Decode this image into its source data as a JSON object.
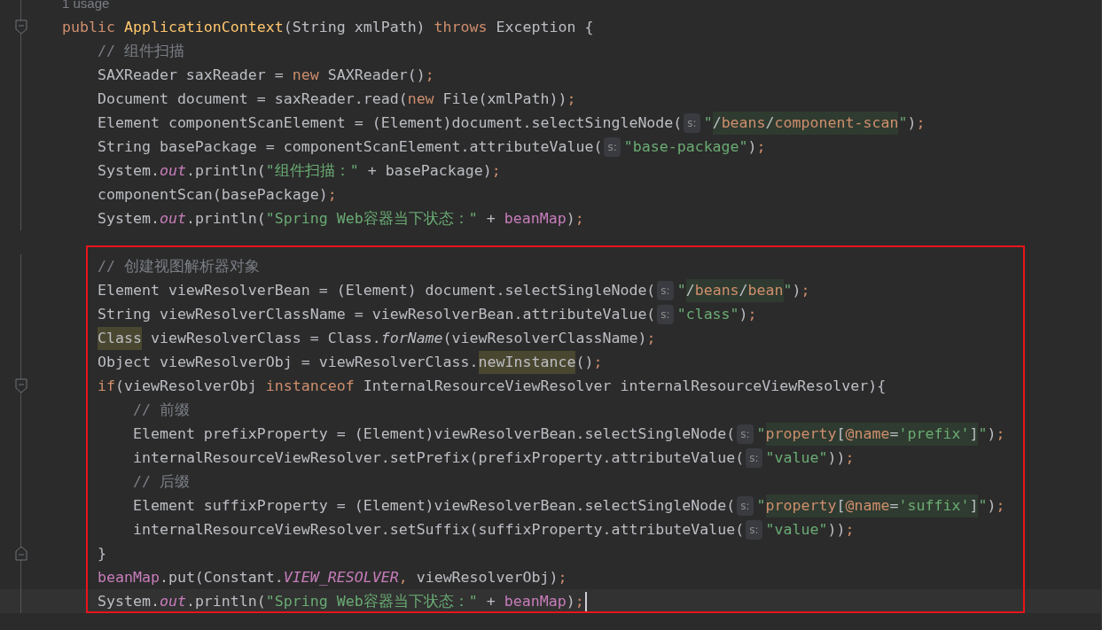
{
  "editor": {
    "groups": [
      {
        "lines": [
          {
            "lens": "1 usage"
          },
          {
            "fold_start": true,
            "tokens": [
              {
                "kind": "kw",
                "text": "public "
              },
              {
                "kind": "decl",
                "text": "ApplicationContext"
              },
              {
                "kind": "p",
                "text": "(String xmlPath) "
              },
              {
                "kind": "kw",
                "text": "throws "
              },
              {
                "kind": "p",
                "text": "Exception {"
              }
            ]
          },
          {
            "tokens": [
              {
                "kind": "cmt",
                "text": "    // 组件扫描"
              }
            ]
          },
          {
            "tokens": [
              {
                "kind": "p",
                "text": "    SAXReader saxReader = "
              },
              {
                "kind": "kw",
                "text": "new "
              },
              {
                "kind": "p",
                "text": "SAXReader()"
              },
              {
                "kind": "kw",
                "text": ";"
              }
            ]
          },
          {
            "tokens": [
              {
                "kind": "p",
                "text": "    Document document = saxReader.read("
              },
              {
                "kind": "kw",
                "text": "new "
              },
              {
                "kind": "p",
                "text": "File(xmlPath))"
              },
              {
                "kind": "kw",
                "text": ";"
              }
            ]
          },
          {
            "tokens": [
              {
                "kind": "p",
                "text": "    Element componentScanElement = (Element)document.selectSingleNode("
              },
              {
                "kind": "hint",
                "text": "s:"
              },
              {
                "kind": "str",
                "text": "\""
              },
              {
                "kind": "injp",
                "text": "/"
              },
              {
                "kind": "injk",
                "text": "beans"
              },
              {
                "kind": "injp",
                "text": "/"
              },
              {
                "kind": "injk",
                "text": "component-scan"
              },
              {
                "kind": "str",
                "text": "\""
              },
              {
                "kind": "p",
                "text": ")"
              },
              {
                "kind": "kw",
                "text": ";"
              }
            ]
          },
          {
            "tokens": [
              {
                "kind": "p",
                "text": "    String basePackage = componentScanElement.attributeValue("
              },
              {
                "kind": "hint",
                "text": "s:"
              },
              {
                "kind": "str",
                "text": "\"base-package\""
              },
              {
                "kind": "p",
                "text": ")"
              },
              {
                "kind": "kw",
                "text": ";"
              }
            ]
          },
          {
            "tokens": [
              {
                "kind": "p",
                "text": "    System."
              },
              {
                "kind": "field",
                "text": "out"
              },
              {
                "kind": "p",
                "text": ".println("
              },
              {
                "kind": "str",
                "text": "\"组件扫描：\""
              },
              {
                "kind": "p",
                "text": " + basePackage)"
              },
              {
                "kind": "kw",
                "text": ";"
              }
            ]
          },
          {
            "tokens": [
              {
                "kind": "p",
                "text": "    componentScan(basePackage)"
              },
              {
                "kind": "kw",
                "text": ";"
              }
            ]
          },
          {
            "tokens": [
              {
                "kind": "p",
                "text": "    System."
              },
              {
                "kind": "field",
                "text": "out"
              },
              {
                "kind": "p",
                "text": ".println("
              },
              {
                "kind": "str",
                "text": "\"Spring Web容器当下状态：\""
              },
              {
                "kind": "p",
                "text": " + "
              },
              {
                "kind": "fieldp",
                "text": "beanMap"
              },
              {
                "kind": "p",
                "text": ")"
              },
              {
                "kind": "kw",
                "text": ";"
              }
            ]
          }
        ]
      },
      {
        "framed": true,
        "lines": [
          {
            "tokens": [
              {
                "kind": "cmt",
                "text": "    // 创建视图解析器对象"
              }
            ]
          },
          {
            "tokens": [
              {
                "kind": "p",
                "text": "    Element viewResolverBean = (Element) document.selectSingleNode("
              },
              {
                "kind": "hint",
                "text": "s:"
              },
              {
                "kind": "str",
                "text": "\""
              },
              {
                "kind": "injp",
                "text": "/"
              },
              {
                "kind": "injk",
                "text": "beans"
              },
              {
                "kind": "injp",
                "text": "/"
              },
              {
                "kind": "injk",
                "text": "bean"
              },
              {
                "kind": "str",
                "text": "\""
              },
              {
                "kind": "p",
                "text": ")"
              },
              {
                "kind": "kw",
                "text": ";"
              }
            ]
          },
          {
            "tokens": [
              {
                "kind": "p",
                "text": "    String viewResolverClassName = viewResolverBean.attributeValue("
              },
              {
                "kind": "hint",
                "text": "s:"
              },
              {
                "kind": "str",
                "text": "\"class\""
              },
              {
                "kind": "p",
                "text": ")"
              },
              {
                "kind": "kw",
                "text": ";"
              }
            ]
          },
          {
            "tokens": [
              {
                "kind": "occ",
                "text": "    Class"
              },
              {
                "kind": "p",
                "text": " viewResolverClass = Class."
              },
              {
                "kind": "static",
                "text": "forName"
              },
              {
                "kind": "p",
                "text": "(viewResolverClassName)"
              },
              {
                "kind": "kw",
                "text": ";"
              }
            ]
          },
          {
            "tokens": [
              {
                "kind": "p",
                "text": "    Object viewResolverObj = viewResolverClass."
              },
              {
                "kind": "occ",
                "text": "newInstance"
              },
              {
                "kind": "p",
                "text": "()"
              },
              {
                "kind": "kw",
                "text": ";"
              }
            ]
          },
          {
            "fold_start": true,
            "tokens": [
              {
                "kind": "kw",
                "text": "    if"
              },
              {
                "kind": "p",
                "text": "(viewResolverObj "
              },
              {
                "kind": "kw",
                "text": "instanceof"
              },
              {
                "kind": "p",
                "text": " InternalResourceViewResolver internalResourceViewResolver){"
              }
            ]
          },
          {
            "tokens": [
              {
                "kind": "cmt",
                "text": "        // 前缀"
              }
            ]
          },
          {
            "tokens": [
              {
                "kind": "p",
                "text": "        Element prefixProperty = (Element)viewResolverBean.selectSingleNode("
              },
              {
                "kind": "hint",
                "text": "s:"
              },
              {
                "kind": "str",
                "text": "\""
              },
              {
                "kind": "injk",
                "text": "property"
              },
              {
                "kind": "injp",
                "text": "["
              },
              {
                "kind": "injk",
                "text": "@name"
              },
              {
                "kind": "injp",
                "text": "="
              },
              {
                "kind": "injs",
                "text": "'prefix'"
              },
              {
                "kind": "injp",
                "text": "]"
              },
              {
                "kind": "str",
                "text": "\""
              },
              {
                "kind": "p",
                "text": ")"
              },
              {
                "kind": "kw",
                "text": ";"
              }
            ]
          },
          {
            "tokens": [
              {
                "kind": "p",
                "text": "        internalResourceViewResolver.setPrefix(prefixProperty.attributeValue("
              },
              {
                "kind": "hint",
                "text": "s:"
              },
              {
                "kind": "str",
                "text": "\"value\""
              },
              {
                "kind": "p",
                "text": "))"
              },
              {
                "kind": "kw",
                "text": ";"
              }
            ]
          },
          {
            "tokens": [
              {
                "kind": "cmt",
                "text": "        // 后缀"
              }
            ]
          },
          {
            "tokens": [
              {
                "kind": "p",
                "text": "        Element suffixProperty = (Element)viewResolverBean.selectSingleNode("
              },
              {
                "kind": "hint",
                "text": "s:"
              },
              {
                "kind": "str",
                "text": "\""
              },
              {
                "kind": "injk",
                "text": "property"
              },
              {
                "kind": "injp",
                "text": "["
              },
              {
                "kind": "injk",
                "text": "@name"
              },
              {
                "kind": "injp",
                "text": "="
              },
              {
                "kind": "injs",
                "text": "'suffix'"
              },
              {
                "kind": "injp",
                "text": "]"
              },
              {
                "kind": "str",
                "text": "\""
              },
              {
                "kind": "p",
                "text": ")"
              },
              {
                "kind": "kw",
                "text": ";"
              }
            ]
          },
          {
            "tokens": [
              {
                "kind": "p",
                "text": "        internalResourceViewResolver.setSuffix(suffixProperty.attributeValue("
              },
              {
                "kind": "hint",
                "text": "s:"
              },
              {
                "kind": "str",
                "text": "\"value\""
              },
              {
                "kind": "p",
                "text": "))"
              },
              {
                "kind": "kw",
                "text": ";"
              }
            ]
          },
          {
            "fold_end": true,
            "tokens": [
              {
                "kind": "p",
                "text": "    }"
              }
            ]
          },
          {
            "tokens": [
              {
                "kind": "fieldp",
                "text": "    beanMap"
              },
              {
                "kind": "p",
                "text": ".put(Constant."
              },
              {
                "kind": "const",
                "text": "VIEW_RESOLVER"
              },
              {
                "kind": "kw",
                "text": ","
              },
              {
                "kind": "p",
                "text": " viewResolverObj)"
              },
              {
                "kind": "kw",
                "text": ";"
              }
            ]
          },
          {
            "current": true,
            "caret": true,
            "tokens": [
              {
                "kind": "p",
                "text": "    System."
              },
              {
                "kind": "field",
                "text": "out"
              },
              {
                "kind": "p",
                "text": ".println("
              },
              {
                "kind": "str",
                "text": "\"Spring Web容器当下状态：\""
              },
              {
                "kind": "p",
                "text": " + "
              },
              {
                "kind": "fieldp",
                "text": "beanMap"
              },
              {
                "kind": "p",
                "text": ")"
              },
              {
                "kind": "kw",
                "text": ";"
              }
            ]
          }
        ]
      }
    ]
  }
}
